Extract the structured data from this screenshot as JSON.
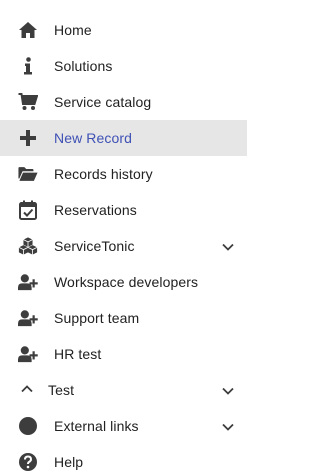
{
  "nav": {
    "items": [
      {
        "label": "Home",
        "icon": "home-icon"
      },
      {
        "label": "Solutions",
        "icon": "info-icon"
      },
      {
        "label": "Service catalog",
        "icon": "cart-icon"
      },
      {
        "label": "New Record",
        "icon": "plus-icon",
        "active": true
      },
      {
        "label": "Records history",
        "icon": "folder-open-icon"
      },
      {
        "label": "Reservations",
        "icon": "calendar-check-icon"
      },
      {
        "label": "ServiceTonic",
        "icon": "cubes-icon",
        "expandable": true
      },
      {
        "label": "Workspace developers",
        "icon": "user-plus-icon"
      },
      {
        "label": "Support team",
        "icon": "user-plus-icon"
      },
      {
        "label": "HR test",
        "icon": "user-plus-icon"
      },
      {
        "label": "Test",
        "icon": "chevron-up-icon",
        "expandable": true,
        "expanded": true
      },
      {
        "label": "External links",
        "icon": "circle-icon",
        "expandable": true
      },
      {
        "label": "Help",
        "icon": "help-circle-icon"
      }
    ]
  },
  "colors": {
    "icon": "#3d3d3d",
    "text": "#212121",
    "active_bg": "#e6e6e6",
    "active_text": "#3f51b5"
  }
}
